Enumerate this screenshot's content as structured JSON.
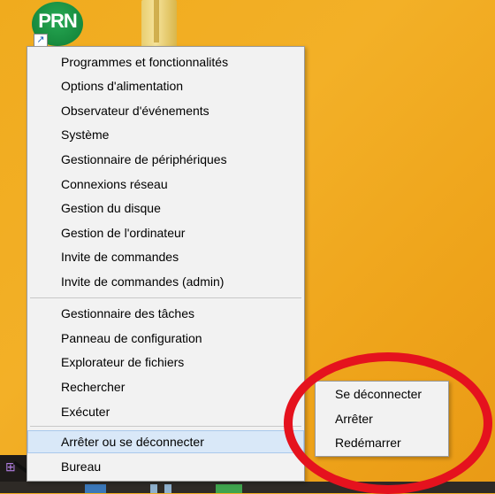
{
  "desktop": {
    "prn_icon_text": "PRN",
    "shortcut_arrow": "↗",
    "start_mark": "⊞"
  },
  "menu": {
    "items": [
      {
        "label": "Programmes et fonctionnalités"
      },
      {
        "label": "Options d'alimentation"
      },
      {
        "label": "Observateur d'événements"
      },
      {
        "label": "Système"
      },
      {
        "label": "Gestionnaire de périphériques"
      },
      {
        "label": "Connexions réseau"
      },
      {
        "label": "Gestion du disque"
      },
      {
        "label": "Gestion de l'ordinateur"
      },
      {
        "label": "Invite de commandes"
      },
      {
        "label": "Invite de commandes (admin)"
      },
      {
        "label": "Gestionnaire des tâches"
      },
      {
        "label": "Panneau de configuration"
      },
      {
        "label": "Explorateur de fichiers"
      },
      {
        "label": "Rechercher"
      },
      {
        "label": "Exécuter"
      },
      {
        "label": "Arrêter ou se déconnecter"
      },
      {
        "label": "Bureau"
      }
    ]
  },
  "submenu": {
    "items": [
      {
        "label": "Se déconnecter"
      },
      {
        "label": "Arrêter"
      },
      {
        "label": "Redémarrer"
      }
    ]
  },
  "colors": {
    "annotation": "#e5121e",
    "highlight": "#d9e8f8",
    "desktop": "#f0ab1e"
  }
}
